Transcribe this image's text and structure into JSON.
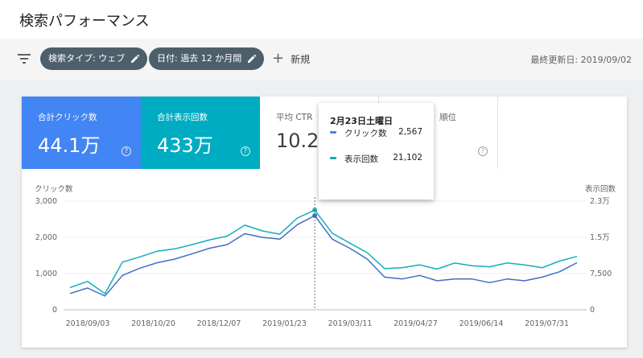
{
  "header": {
    "title": "検索パフォーマンス"
  },
  "toolbar": {
    "filter_icon": "filter-icon",
    "chip_search_type": "検索タイプ: ウェブ",
    "chip_date": "日付: 過去 12 か月間",
    "new_label": "新規",
    "last_updated": "最終更新日: 2019/09/02"
  },
  "metrics": [
    {
      "label": "合計クリック数",
      "value": "44.1万",
      "color": "#4285f4"
    },
    {
      "label": "合計表示回数",
      "value": "433万",
      "color": "#00acc1"
    },
    {
      "label": "平均 CTR",
      "value": "10.2"
    },
    {
      "label": "順位",
      "value": ""
    }
  ],
  "tooltip": {
    "date": "2月23日土曜日",
    "rows": [
      {
        "name": "クリック数",
        "value": "2,567",
        "color": "#4285f4"
      },
      {
        "name": "表示回数",
        "value": "21,102",
        "color": "#00acc1"
      }
    ]
  },
  "chart_data": {
    "type": "line",
    "ylabel_left": "クリック数",
    "ylabel_right": "表示回数",
    "yticks_left": [
      "3,000",
      "2,000",
      "1,000",
      "0"
    ],
    "yticks_right": [
      "2.3万",
      "1.5万",
      "7,500",
      "0"
    ],
    "xticks": [
      "2018/09/03",
      "2018/10/20",
      "2018/12/07",
      "2019/01/23",
      "2019/03/11",
      "2019/04/27",
      "2019/06/14",
      "2019/07/31"
    ],
    "ylim_left": [
      0,
      3000
    ],
    "ylim_right": [
      0,
      23000
    ],
    "marker_index": 14,
    "series": [
      {
        "name": "クリック数",
        "color": "#3f6fc4",
        "values": [
          450,
          600,
          380,
          950,
          1150,
          1300,
          1400,
          1550,
          1700,
          1800,
          2100,
          2000,
          1950,
          2350,
          2600,
          1950,
          1700,
          1400,
          900,
          850,
          950,
          800,
          850,
          850,
          750,
          850,
          800,
          900,
          1050,
          1300
        ]
      },
      {
        "name": "表示回数",
        "color": "#12aebc",
        "values": [
          4700,
          6000,
          3400,
          10100,
          11200,
          12400,
          12900,
          13800,
          14800,
          15600,
          17900,
          16700,
          16000,
          19400,
          21100,
          16200,
          14100,
          12100,
          8700,
          8900,
          9500,
          8600,
          9900,
          9300,
          9100,
          9900,
          9500,
          8900,
          10300,
          11300
        ]
      }
    ]
  }
}
